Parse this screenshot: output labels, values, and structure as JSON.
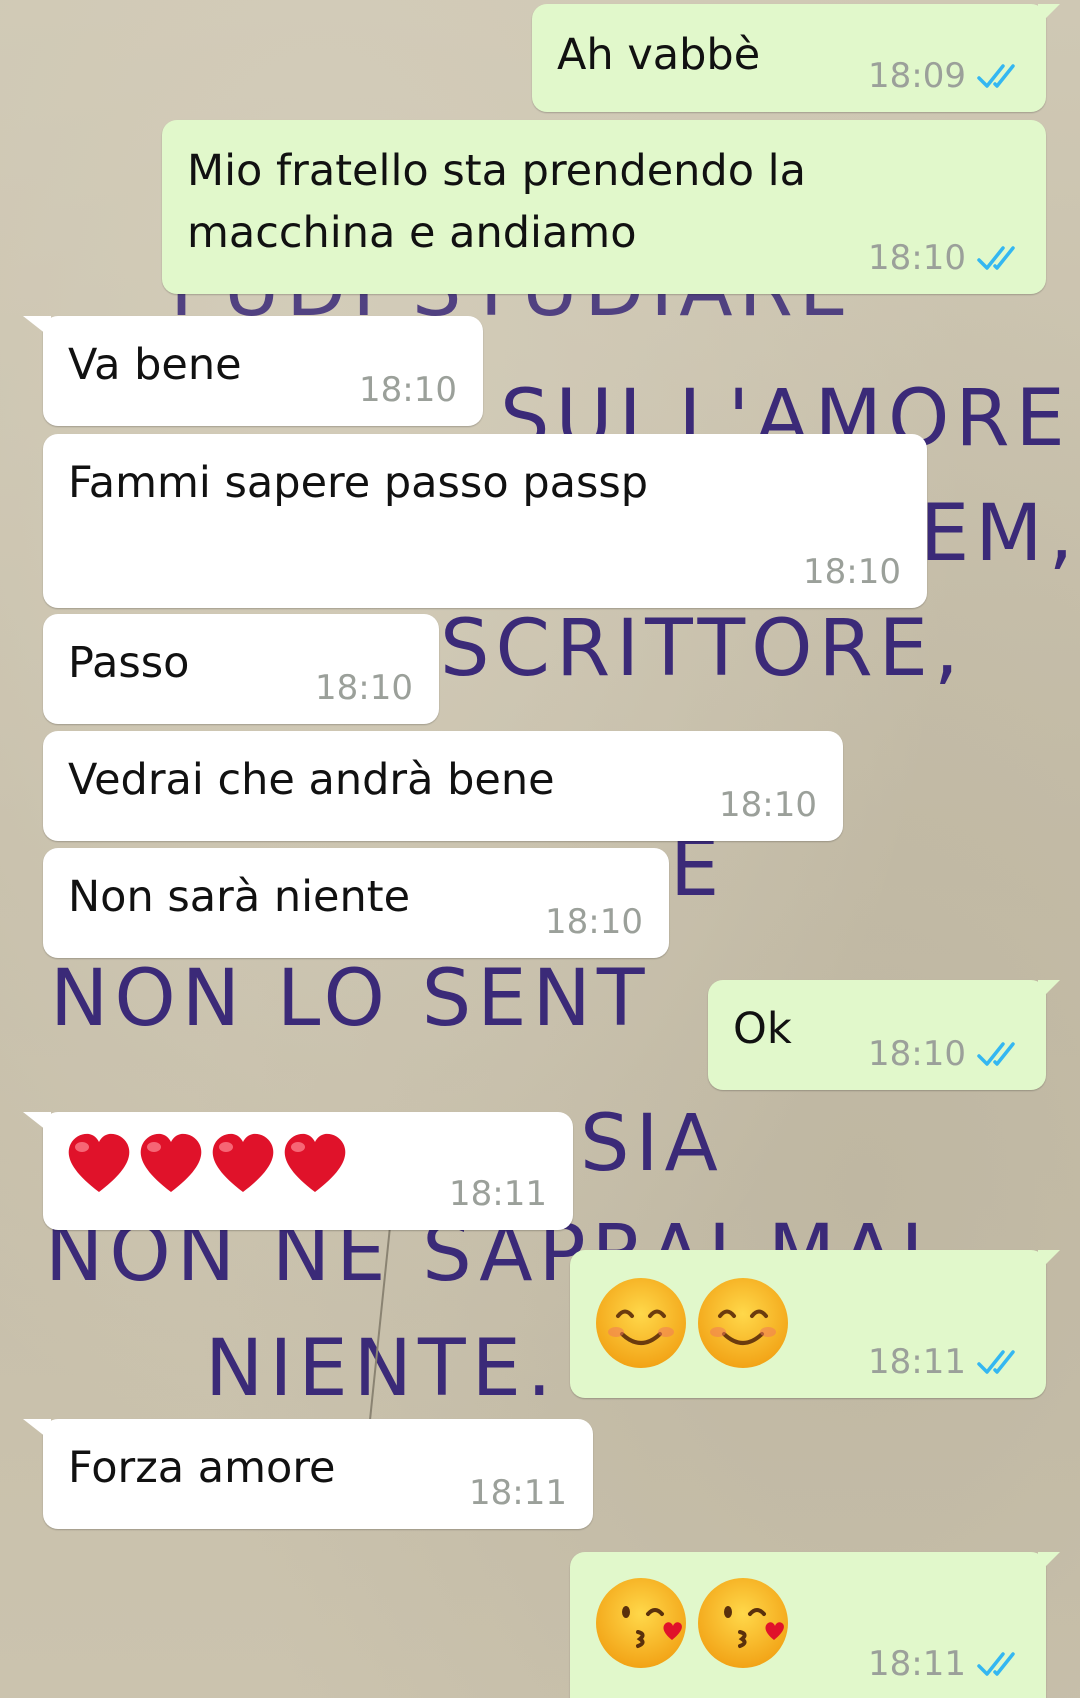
{
  "messages": [
    {
      "direction": "out",
      "text": "Ah vabbè",
      "time": "18:09",
      "status": "read-double-check-icon"
    },
    {
      "direction": "out",
      "text_lines": [
        "Mio fratello sta prendendo la",
        "macchina e andiamo"
      ],
      "time": "18:10",
      "status": "read-double-check-icon"
    },
    {
      "direction": "in",
      "text": "Va bene",
      "time": "18:10"
    },
    {
      "direction": "in",
      "text": "Fammi sapere passo passp",
      "time": "18:10"
    },
    {
      "direction": "in",
      "text": "Passo",
      "time": "18:10"
    },
    {
      "direction": "in",
      "text": "Vedrai che andrà bene",
      "time": "18:10"
    },
    {
      "direction": "in",
      "text": "Non sarà niente",
      "time": "18:10"
    },
    {
      "direction": "out",
      "text": "Ok",
      "time": "18:10",
      "status": "read-double-check-icon"
    },
    {
      "direction": "in",
      "emoji": [
        "red-heart-icon",
        "red-heart-icon",
        "red-heart-icon",
        "red-heart-icon"
      ],
      "time": "18:11"
    },
    {
      "direction": "out",
      "emoji": [
        "smiling-face-icon",
        "smiling-face-icon"
      ],
      "time": "18:11",
      "status": "read-double-check-icon"
    },
    {
      "direction": "in",
      "text": "Forza amore",
      "time": "18:11"
    },
    {
      "direction": "out",
      "emoji": [
        "kissing-face-icon",
        "kissing-face-icon"
      ],
      "time": "18:11",
      "status": "read-double-check-icon"
    }
  ],
  "wallpaper_text": [
    "SUI L'AMORE",
    "EM,",
    "SCRITTORE,",
    "E",
    "NON LO SENT",
    "SIA",
    "NON NE SAPRAI MAI",
    "NIENTE."
  ],
  "colors": {
    "incoming_bubble": "#ffffff",
    "outgoing_bubble": "#e1f8cb",
    "read_tick": "#34b7f1",
    "timestamp": "#9ba09a"
  }
}
